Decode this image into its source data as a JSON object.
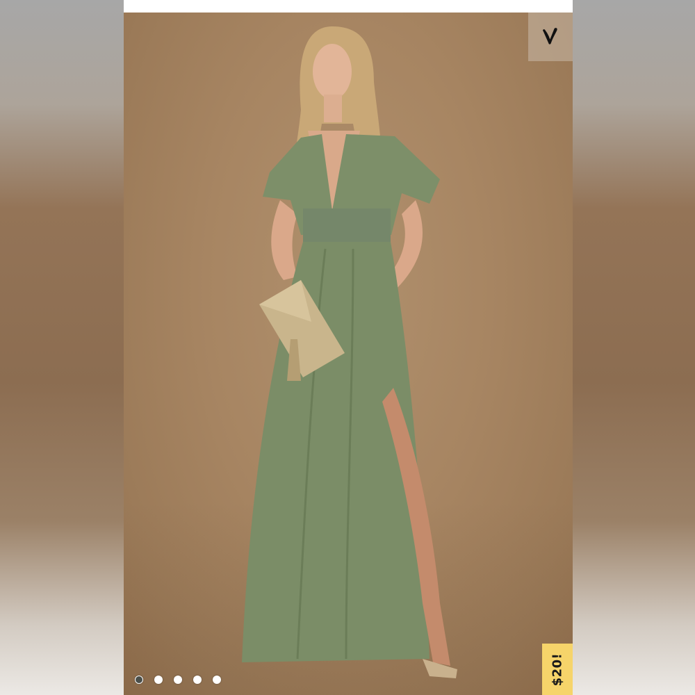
{
  "listing": {
    "price_label": "$20!",
    "carousel": {
      "total_images": 5,
      "active_index": 0
    }
  },
  "colors": {
    "dress": "#7d8f69",
    "backdrop": "#a78562",
    "price_tag": "#f6d46a",
    "clutch": "#c9b58c"
  },
  "icons": {
    "like": "heart-icon"
  }
}
